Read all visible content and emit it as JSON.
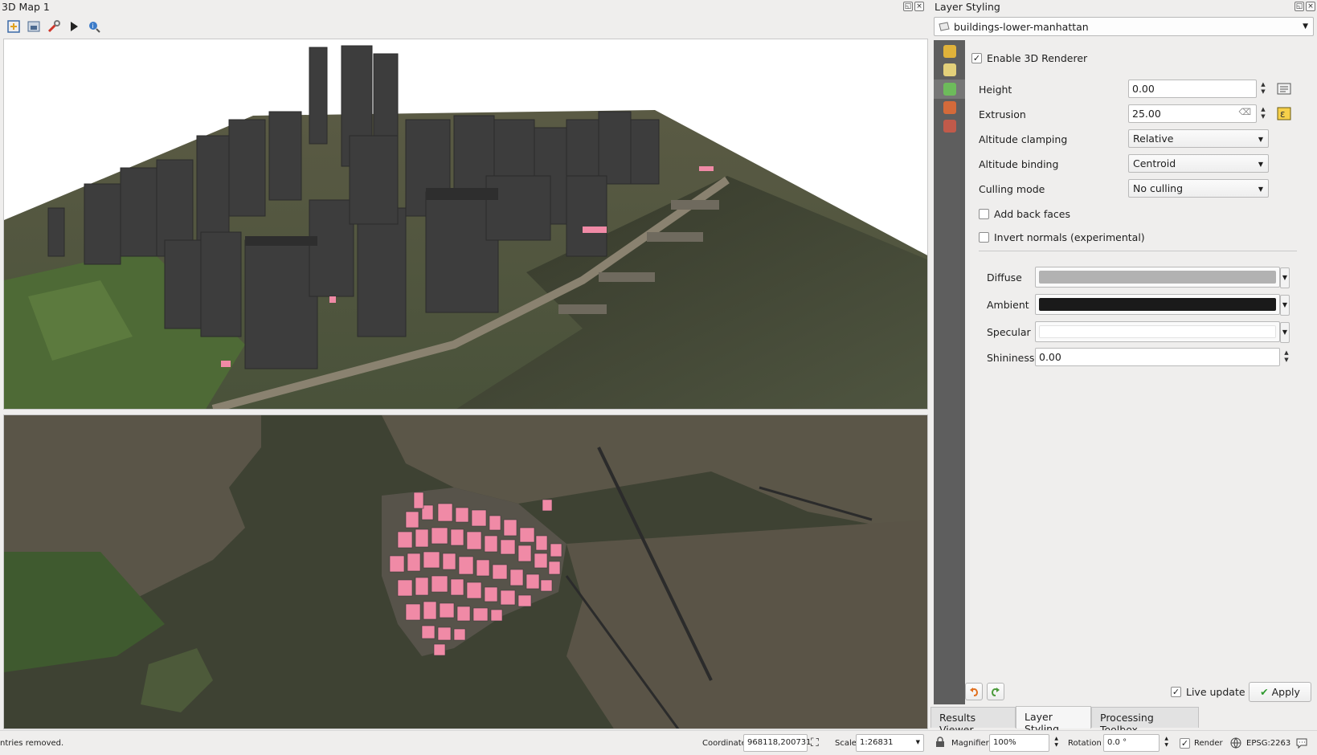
{
  "map3d": {
    "title": "3D Map 1",
    "toolbar_icons": [
      "zoom-full-icon",
      "save-image-icon",
      "configure-icon",
      "play-animation-icon",
      "identify-icon"
    ]
  },
  "layer_styling": {
    "title": "Layer Styling",
    "layer_name": "buildings-lower-manhattan",
    "enable_3d_label": "Enable 3D Renderer",
    "enable_3d_checked": true,
    "height_label": "Height",
    "height_value": "0.00",
    "extrusion_label": "Extrusion",
    "extrusion_value": "25.00",
    "altitude_clamping_label": "Altitude clamping",
    "altitude_clamping_value": "Relative",
    "altitude_binding_label": "Altitude binding",
    "altitude_binding_value": "Centroid",
    "culling_mode_label": "Culling mode",
    "culling_mode_value": "No culling",
    "add_back_faces_label": "Add back faces",
    "invert_normals_label": "Invert normals (experimental)",
    "diffuse_label": "Diffuse",
    "diffuse_color": "#b2b2b2",
    "ambient_label": "Ambient",
    "ambient_color": "#1a1a1a",
    "specular_label": "Specular",
    "specular_color": "#ffffff",
    "shininess_label": "Shininess",
    "shininess_value": "0.00",
    "live_update_label": "Live update",
    "apply_label": "Apply"
  },
  "tabs": [
    {
      "label": "Results Viewer"
    },
    {
      "label": "Layer Styling"
    },
    {
      "label": "Processing Toolbox"
    }
  ],
  "status": {
    "message": "ntries removed.",
    "coordinate_label": "Coordinate",
    "coordinate_value": "968118,200731",
    "scale_label": "Scale",
    "scale_value": "1:26831",
    "magnifier_label": "Magnifier",
    "magnifier_value": "100%",
    "rotation_label": "Rotation",
    "rotation_value": "0.0 °",
    "render_label": "Render",
    "crs_label": "EPSG:2263"
  },
  "colors": {
    "highlight_buildings": "#f08aa6",
    "water": "#3f4433",
    "building_3d": "#3b3b3b"
  }
}
